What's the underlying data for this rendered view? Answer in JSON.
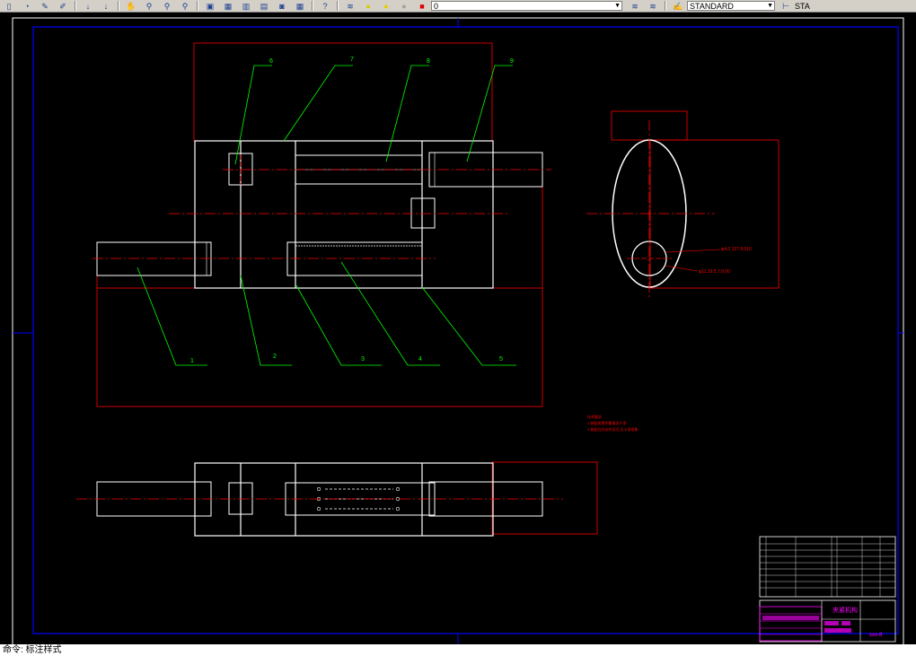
{
  "toolbar": {
    "layer_value": "0",
    "textstyle_value": "STANDARD",
    "dimstyle_value": "STA"
  },
  "drawing": {
    "balloons": [
      "1",
      "2",
      "3",
      "4",
      "5",
      "6",
      "7",
      "8",
      "9"
    ],
    "dim_label_1": "φ4.3 127.9.010",
    "dim_label_2": "φ11.19 5.7.0.00",
    "notes_title": "技术要求",
    "notes_line_1": "1.装配前零件需清洗干净",
    "notes_line_2": "2.装配后应动作灵活,无卡滞现象",
    "title_block_name": "夹紧机构",
    "title_block_code": "xxx-8"
  },
  "status": {
    "command_text": "命令: 标注样式"
  },
  "colors": {
    "background": "#000000",
    "outline": "#ffffff",
    "border": "#0000ff",
    "centerline": "#ff0000",
    "leader": "#00ff00",
    "magenta": "#ff00ff"
  }
}
